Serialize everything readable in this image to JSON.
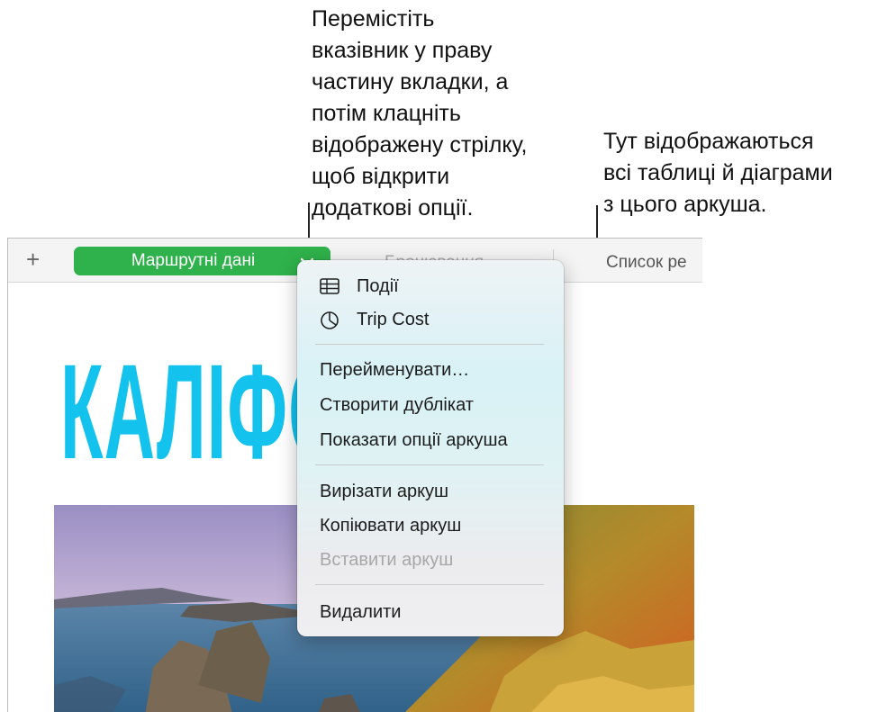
{
  "callouts": {
    "left": "Перемістіть\nвказівник у праву\nчастину вкладки, а\nпотім клацніть\nвідображену стрілку,\nщоб відкрити\nдодаткові опції.",
    "right": "Тут відображаються\nвсі таблиці й діаграми\nз цього аркуша."
  },
  "tabbar": {
    "add_label": "+",
    "active_tab": "Маршрутні дані",
    "tab_booking": "Бронювання",
    "tab_list": "Список ре"
  },
  "document": {
    "title": "КАЛІФО"
  },
  "menu": {
    "items": [
      {
        "label": "Події",
        "icon": "table-icon",
        "enabled": true
      },
      {
        "label": "Trip Cost",
        "icon": "pie-chart-icon",
        "enabled": true
      },
      {
        "label": "Перейменувати…",
        "enabled": true
      },
      {
        "label": "Створити дублікат",
        "enabled": true
      },
      {
        "label": "Показати опції аркуша",
        "enabled": true
      },
      {
        "label": "Вирізати аркуш",
        "enabled": true
      },
      {
        "label": "Копіювати аркуш",
        "enabled": true
      },
      {
        "label": "Вставити аркуш",
        "enabled": false
      },
      {
        "label": "Видалити",
        "enabled": true
      }
    ]
  },
  "colors": {
    "active_tab": "#2fb24b",
    "title": "#13c3ee"
  }
}
